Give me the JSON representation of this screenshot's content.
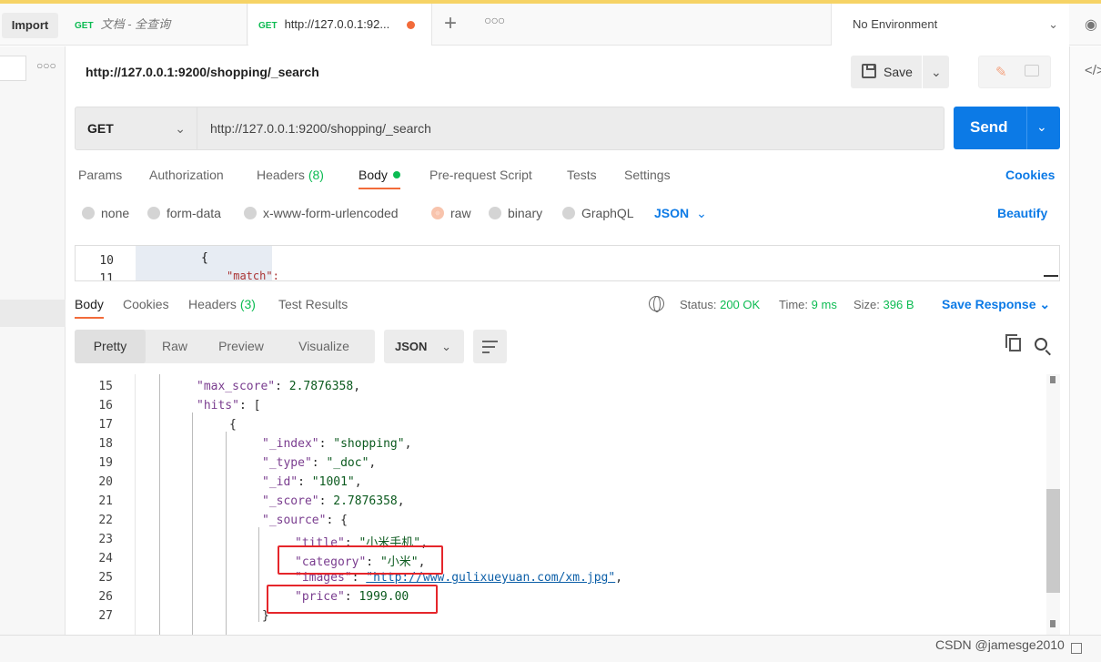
{
  "tabbar": {
    "import_label": "Import",
    "tabs": [
      {
        "method": "GET",
        "title": "文档 - 全查询"
      },
      {
        "method": "GET",
        "title": "http://127.0.0.1:92..."
      }
    ],
    "environment": "No Environment"
  },
  "request": {
    "title": "http://127.0.0.1:9200/shopping/_search",
    "save_label": "Save",
    "method": "GET",
    "url": "http://127.0.0.1:9200/shopping/_search",
    "send_label": "Send",
    "tabs": [
      {
        "label": "Params"
      },
      {
        "label": "Authorization"
      },
      {
        "label": "Headers",
        "count": "(8)"
      },
      {
        "label": "Body"
      },
      {
        "label": "Pre-request Script"
      },
      {
        "label": "Tests"
      },
      {
        "label": "Settings"
      }
    ],
    "cookies_label": "Cookies",
    "body_options": [
      "none",
      "form-data",
      "x-www-form-urlencoded",
      "raw",
      "binary",
      "GraphQL"
    ],
    "selected_body_option": "raw",
    "language": "JSON",
    "beautify_label": "Beautify",
    "editor": {
      "line_numbers": [
        "10",
        "11"
      ],
      "line10_text": "{",
      "line11_text": "\"match\": {"
    }
  },
  "response": {
    "tabs": [
      {
        "label": "Body"
      },
      {
        "label": "Cookies"
      },
      {
        "label": "Headers",
        "count": "(3)"
      },
      {
        "label": "Test Results"
      }
    ],
    "status_label": "Status:",
    "status_value": "200 OK",
    "time_label": "Time:",
    "time_value": "9 ms",
    "size_label": "Size:",
    "size_value": "396 B",
    "save_response_label": "Save Response",
    "view_modes": [
      "Pretty",
      "Raw",
      "Preview",
      "Visualize"
    ],
    "format": "JSON",
    "lines": [
      {
        "num": "15",
        "key": "\"max_score\"",
        "rest": ": ",
        "value": "2.7876358",
        "tail": ","
      },
      {
        "num": "16",
        "key": "\"hits\"",
        "rest": ": [",
        "value": "",
        "tail": ""
      },
      {
        "num": "17",
        "key": "",
        "rest": "{",
        "value": "",
        "tail": ""
      },
      {
        "num": "18",
        "key": "\"_index\"",
        "rest": ": ",
        "value": "\"shopping\"",
        "tail": ","
      },
      {
        "num": "19",
        "key": "\"_type\"",
        "rest": ": ",
        "value": "\"_doc\"",
        "tail": ","
      },
      {
        "num": "20",
        "key": "\"_id\"",
        "rest": ": ",
        "value": "\"1001\"",
        "tail": ","
      },
      {
        "num": "21",
        "key": "\"_score\"",
        "rest": ": ",
        "value": "2.7876358",
        "tail": ","
      },
      {
        "num": "22",
        "key": "\"_source\"",
        "rest": ": {",
        "value": "",
        "tail": ""
      },
      {
        "num": "23",
        "key": "\"title\"",
        "rest": ": ",
        "value": "\"小米手机\"",
        "tail": ","
      },
      {
        "num": "24",
        "key": "\"category\"",
        "rest": ": ",
        "value": "\"小米\"",
        "tail": ","
      },
      {
        "num": "25",
        "key": "\"images\"",
        "rest": ": ",
        "value": "\"http://www.gulixueyuan.com/xm.jpg\"",
        "tail": ","
      },
      {
        "num": "26",
        "key": "\"price\"",
        "rest": ": ",
        "value": "1999.00",
        "tail": ""
      },
      {
        "num": "27",
        "key": "",
        "rest": "}",
        "value": "",
        "tail": ""
      }
    ]
  },
  "watermark": "CSDN @jamesge2010",
  "colors": {
    "accent_blue": "#0c7ae6",
    "method_green": "#0cbb52",
    "active_orange": "#f26b3a",
    "highlight_red": "#e5262b"
  }
}
